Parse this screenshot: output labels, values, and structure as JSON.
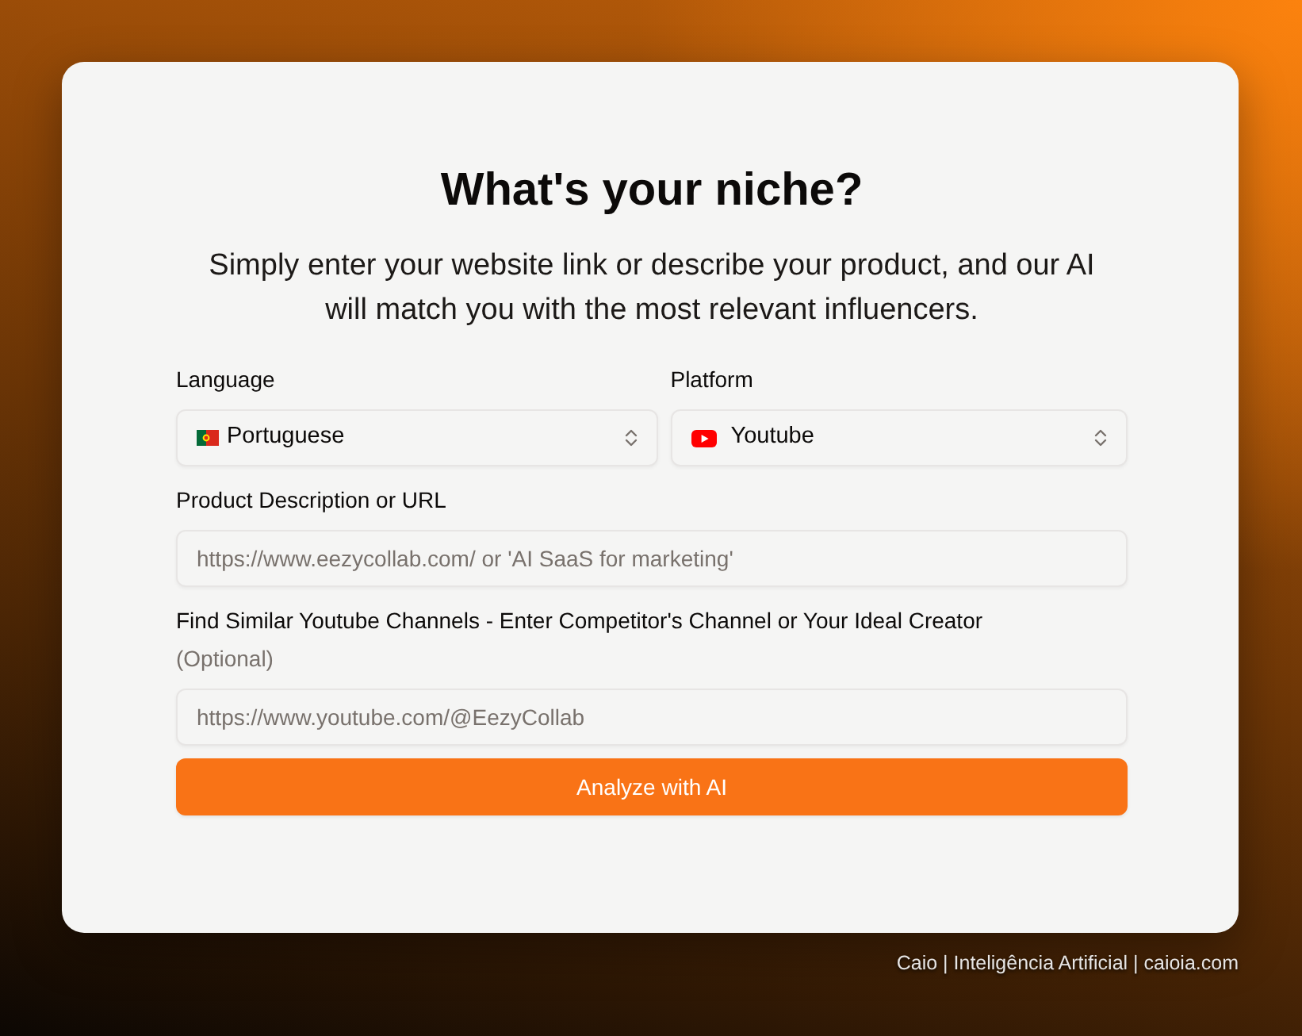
{
  "title": "What's your niche?",
  "subtitle": "Simply enter your website link or describe your product, and our AI will match you with the most relevant influencers.",
  "language": {
    "label": "Language",
    "value": "Portuguese"
  },
  "platform": {
    "label": "Platform",
    "value": "Youtube"
  },
  "product": {
    "label": "Product Description or URL",
    "placeholder": "https://www.eezycollab.com/ or 'AI SaaS for marketing'"
  },
  "similar_channel": {
    "label": "Find Similar Youtube Channels - Enter Competitor's Channel or Your Ideal Creator",
    "note": "(Optional)",
    "placeholder": "https://www.youtube.com/@EezyCollab"
  },
  "submit_button": "Analyze with AI",
  "footer": "Caio | Inteligência Artificial | caioia.com"
}
